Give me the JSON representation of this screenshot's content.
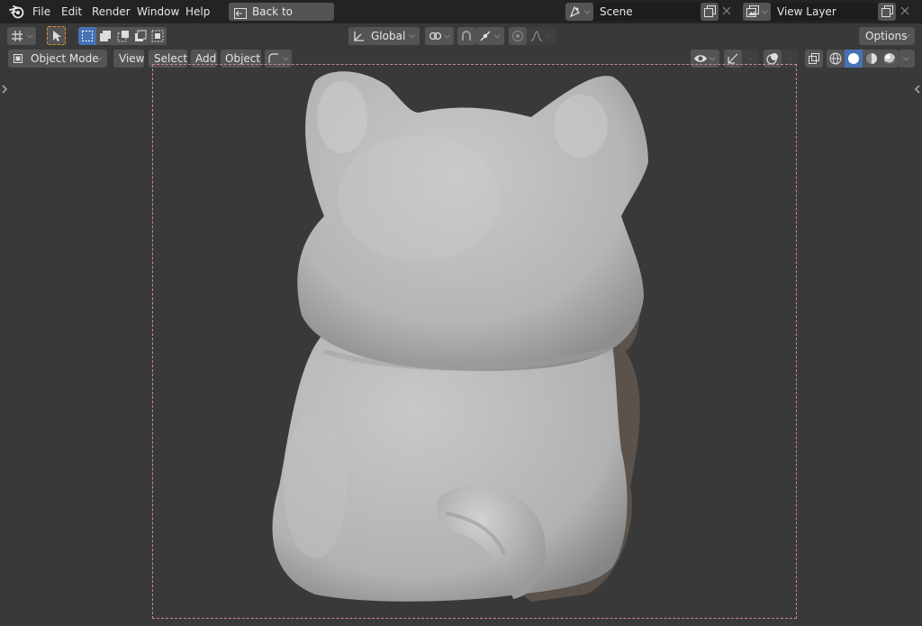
{
  "menu": {
    "file": "File",
    "edit": "Edit",
    "render": "Render",
    "window": "Window",
    "help": "Help",
    "back_to_previous": "Back to Previous"
  },
  "scene": {
    "name": "Scene"
  },
  "view_layer": {
    "name": "View Layer"
  },
  "toolbar": {
    "transform_orientation": "Global",
    "options": "Options"
  },
  "header": {
    "mode": "Object Mode",
    "view": "View",
    "select": "Select",
    "add": "Add",
    "object": "Object"
  },
  "colors": {
    "topbar_bg": "#232323",
    "viewport_bg": "#393939",
    "button_bg": "#545454",
    "active_blue": "#4772b3",
    "camera_frame": "#d08888",
    "active_tool_border": "#e08d2c"
  },
  "icons": [
    "blender-logo-icon",
    "back-to-previous-icon",
    "scene-icon",
    "view-layer-icon",
    "new-scene-icon",
    "close-icon",
    "editor-type-icon",
    "select-tool-icon",
    "select-box-new-icon",
    "select-box-extend-icon",
    "select-box-subtract-icon",
    "select-box-invert-icon",
    "transform-orientation-icon",
    "pivot-point-icon",
    "snap-icon",
    "snap-target-icon",
    "proportional-edit-icon",
    "falloff-icon",
    "object-mode-icon",
    "shading-icon",
    "visibility-icon",
    "gizmo-icon",
    "overlay-icon",
    "xray-icon",
    "wireframe-shading-icon",
    "solid-shading-icon",
    "material-shading-icon",
    "rendered-shading-icon",
    "expand-left-icon",
    "expand-right-icon"
  ]
}
